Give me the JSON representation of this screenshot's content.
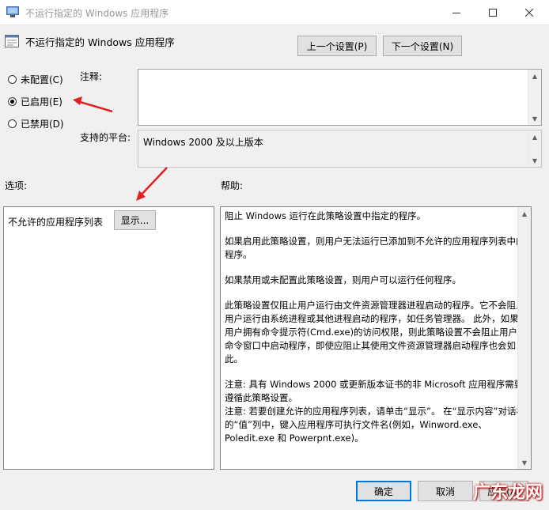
{
  "window": {
    "title": "不运行指定的 Windows 应用程序",
    "controls": [
      "minimize-icon",
      "maximize-icon",
      "close-icon"
    ]
  },
  "header": {
    "title": "不运行指定的 Windows 应用程序",
    "prev_button": "上一个设置(P)",
    "next_button": "下一个设置(N)"
  },
  "state": {
    "options": [
      {
        "label": "未配置(C)",
        "selected": false
      },
      {
        "label": "已启用(E)",
        "selected": true
      },
      {
        "label": "已禁用(D)",
        "selected": false
      }
    ]
  },
  "comment": {
    "label": "注释:",
    "value": ""
  },
  "platform": {
    "label": "支持的平台:",
    "value": "Windows 2000 及以上版本"
  },
  "options_section": {
    "label": "选项:",
    "item_label": "不允许的应用程序列表",
    "show_button": "显示..."
  },
  "help_section": {
    "label": "帮助:",
    "paragraphs": [
      "阻止 Windows 运行在此策略设置中指定的程序。",
      "如果启用此策略设置，则用户无法运行已添加到不允许的应用程序列表中的程序。",
      "如果禁用或未配置此策略设置，则用户可以运行任何程序。",
      "此策略设置仅阻止用户运行由文件资源管理器进程启动的程序。它不会阻止用户运行由系统进程或其他进程启动的程序，如任务管理器。 此外，如果用户拥有命令提示符(Cmd.exe)的访问权限，则此策略设置不会阻止用户在命令窗口中启动程序，即使应阻止其使用文件资源管理器启动程序也会如此。",
      "注意: 具有 Windows 2000 或更新版本证书的非 Microsoft 应用程序需要遵循此策略设置。",
      "注意: 若要创建允许的应用程序列表，请单击“显示”。 在“显示内容”对话框的“值”列中，键入应用程序可执行文件名(例如，Winword.exe、Poledit.exe 和 Powerpnt.exe)。"
    ]
  },
  "footer": {
    "ok_button": "确定",
    "cancel_button": "取消",
    "apply_button": "应用(A)"
  },
  "watermark": "广东龙网",
  "annotation_color": "#e02020"
}
